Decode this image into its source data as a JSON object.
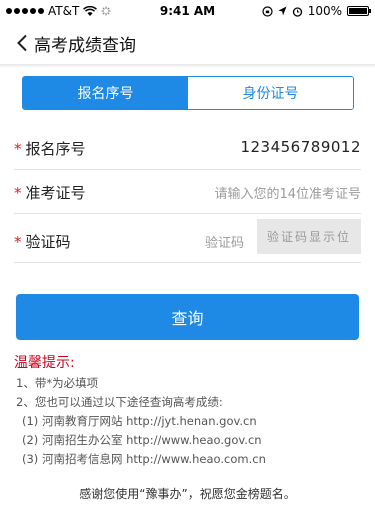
{
  "status_bar": {
    "carrier": "AT&T",
    "time": "9:41 AM",
    "battery": "100%",
    "battery_level": 1.0
  },
  "nav": {
    "back_icon": "chevron-left-icon",
    "title": "高考成绩查询"
  },
  "tabs": [
    {
      "label": "报名序号",
      "active": true
    },
    {
      "label": "身份证号",
      "active": false
    }
  ],
  "form": {
    "registration": {
      "label": "报名序号",
      "required_mark": "*",
      "value": "123456789012"
    },
    "ticket": {
      "label": "准考证号",
      "required_mark": "*",
      "placeholder": "请输入您的14位准考证号"
    },
    "captcha": {
      "label": "验证码",
      "required_mark": "*",
      "placeholder": "验证码",
      "image_text": "验证码显示位"
    }
  },
  "query_button": "查询",
  "tips": {
    "title": "温馨提示:",
    "line1": "1、带*为必填项",
    "line2": "2、您也可以通过以下途径查询高考成绩:",
    "sources": [
      "(1) 河南教育厅网站 http://jyt.henan.gov.cn",
      "(2) 河南招生办公室 http://www.heao.gov.cn",
      "(3) 河南招考信息网 http://www.heao.com.cn"
    ]
  },
  "footer": "感谢您使用“豫事办”，祝愿您金榜题名。",
  "colors": {
    "accent": "#1e8ae6",
    "required": "#e02020",
    "tips_title": "#d0021b"
  }
}
